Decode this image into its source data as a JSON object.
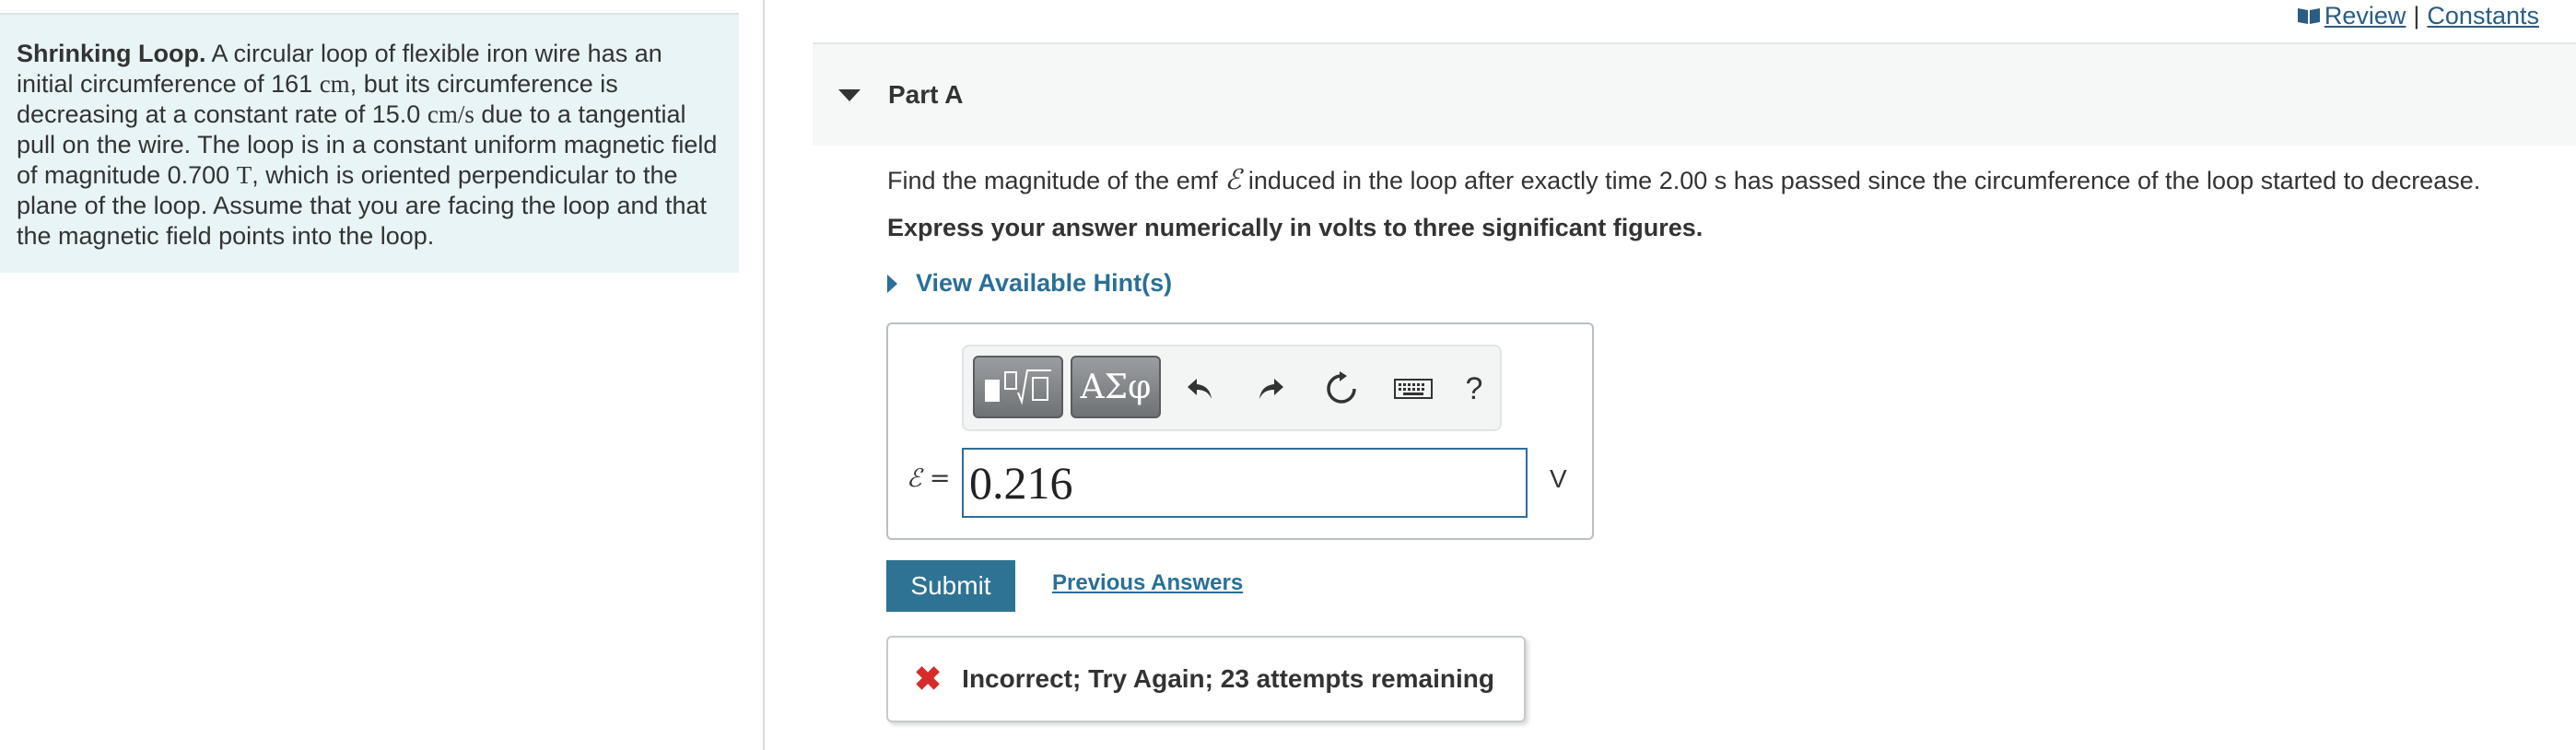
{
  "header": {
    "review_label": "Review",
    "separator": "|",
    "constants_label": "Constants",
    "link_color": "#2a5d84"
  },
  "problem": {
    "title": "Shrinking Loop.",
    "text_1": "A circular loop of flexible iron wire has an initial circumference of",
    "circumference_value": "161",
    "circumference_unit": "cm",
    "text_2": ", but its circumference is decreasing at a constant rate of",
    "rate_value": "15.0",
    "rate_unit": "cm/s",
    "text_3": "due to a tangential pull on the wire. The loop is in a constant uniform magnetic field of magnitude",
    "field_value": "0.700",
    "field_unit": "T",
    "text_4": ", which is oriented perpendicular to the plane of the loop. Assume that you are facing the loop and that the magnetic field points into the loop."
  },
  "part": {
    "title": "Part A",
    "question_1": "Find the magnitude of the emf",
    "emf_symbol": "ℰ",
    "question_2": "induced in the loop after exactly time",
    "time_value": "2.00",
    "question_3": "s has passed since the circumference of the loop started to decrease.",
    "instruction": "Express your answer numerically in volts to three significant figures.",
    "hint_label": "View Available Hint(s)"
  },
  "toolbar": {
    "templates_icon": "templates-icon",
    "greek_label": "ΑΣφ",
    "undo_icon": "undo-icon",
    "redo_icon": "redo-icon",
    "reset_icon": "reset-icon",
    "keyboard_icon": "keyboard-icon",
    "help_label": "?"
  },
  "answer": {
    "label": "ℰ =",
    "value": "0.216",
    "unit": "V"
  },
  "actions": {
    "submit_label": "Submit",
    "previous_answers_label": "Previous Answers",
    "submit_color": "#2e7394"
  },
  "feedback": {
    "icon": "x-icon",
    "text": "Incorrect; Try Again; 23 attempts remaining",
    "icon_color": "#d62b2b"
  }
}
